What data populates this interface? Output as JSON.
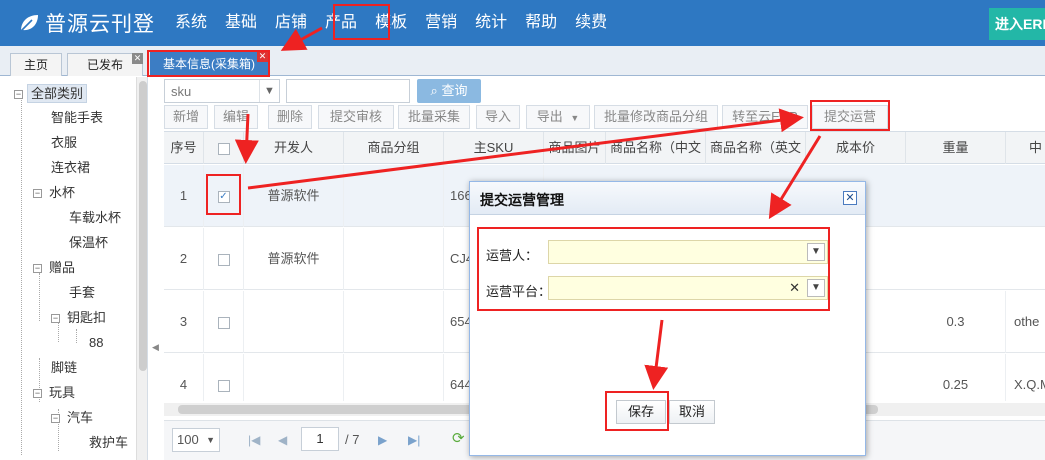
{
  "app": {
    "logo_text": "普源云刊登",
    "erp_button": "进入ERP"
  },
  "nav": {
    "items": [
      "系统",
      "基础",
      "店铺",
      "产品",
      "模板",
      "营销",
      "统计",
      "帮助",
      "续费"
    ]
  },
  "tabs": [
    {
      "label": "主页",
      "closable": false
    },
    {
      "label": "已发布",
      "closable": true
    },
    {
      "label": "基本信息(采集箱)",
      "closable": true,
      "active": true
    }
  ],
  "tree": {
    "root": "全部类别",
    "nodes": [
      {
        "label": "智能手表"
      },
      {
        "label": "衣服"
      },
      {
        "label": "连衣裙"
      },
      {
        "label": "水杯"
      },
      {
        "label": "车载水杯"
      },
      {
        "label": "保温杯"
      },
      {
        "label": "赠品"
      },
      {
        "label": "手套"
      },
      {
        "label": "钥匙扣"
      },
      {
        "label": "88"
      },
      {
        "label": "脚链"
      },
      {
        "label": "玩具"
      },
      {
        "label": "汽车"
      },
      {
        "label": "救护车"
      }
    ]
  },
  "search": {
    "field_select": "sku",
    "query_button": "查询"
  },
  "toolbar": {
    "buttons": [
      "新增",
      "编辑",
      "删除",
      "提交审核",
      "批量采集",
      "导入",
      "导出",
      "批量修改商品分组",
      "转至云ERP",
      "提交运营"
    ]
  },
  "grid": {
    "columns": [
      "序号",
      "",
      "开发人",
      "商品分组",
      "主SKU",
      "商品图片",
      "商品名称（中文",
      "商品名称（英文",
      "成本价",
      "重量",
      "中"
    ],
    "rows": [
      {
        "index": "1",
        "checked": true,
        "developer": "普源软件",
        "sku": "166",
        "weight": "",
        "extra": ""
      },
      {
        "index": "2",
        "checked": false,
        "developer": "普源软件",
        "sku": "CJ4",
        "weight": "",
        "extra": ""
      },
      {
        "index": "3",
        "checked": false,
        "developer": "",
        "sku": "654",
        "weight": "0.3",
        "extra": "othe"
      },
      {
        "index": "4",
        "checked": false,
        "developer": "",
        "sku": "644",
        "weight": "0.25",
        "extra": "X.Q.M."
      }
    ]
  },
  "pager": {
    "page_size": "100",
    "current_page": "1",
    "total_pages": "/ 7"
  },
  "dialog": {
    "title": "提交运营管理",
    "operator_label": "运营人：",
    "platform_label": "运营平台：",
    "operator_value": "",
    "platform_value": "",
    "save_button": "保存",
    "cancel_button": "取消"
  },
  "colors": {
    "topbar": "#2e78c2",
    "accent": "#3c7dc4",
    "annotation_red": "#e22",
    "erp_button": "#23b7a7"
  }
}
